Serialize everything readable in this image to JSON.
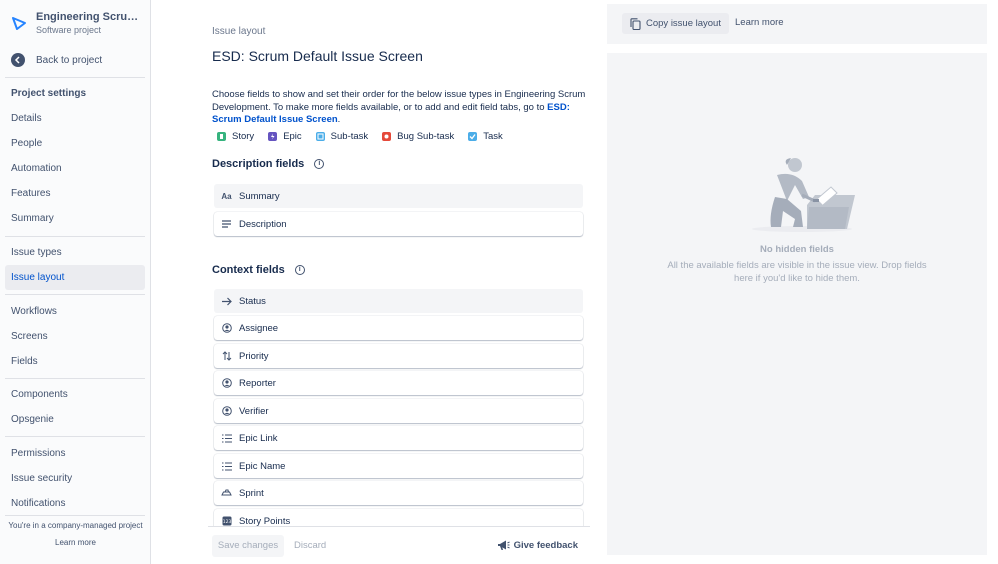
{
  "sidebar": {
    "project_name": "Engineering Scrum Development",
    "project_type": "Software project",
    "back_label": "Back to project",
    "section_title": "Project settings",
    "items": [
      {
        "label": "Details"
      },
      {
        "label": "People"
      },
      {
        "label": "Automation"
      },
      {
        "label": "Features"
      },
      {
        "label": "Summary"
      },
      {
        "label": "Issue types"
      },
      {
        "label": "Issue layout"
      },
      {
        "label": "Workflows"
      },
      {
        "label": "Screens"
      },
      {
        "label": "Fields"
      },
      {
        "label": "Components"
      },
      {
        "label": "Opsgenie"
      },
      {
        "label": "Permissions"
      },
      {
        "label": "Issue security"
      },
      {
        "label": "Notifications"
      }
    ],
    "active_item": "Issue layout",
    "footer_note": "You're in a company-managed project",
    "footer_link": "Learn more"
  },
  "main": {
    "breadcrumb": "Issue layout",
    "title": "ESD: Scrum Default Issue Screen",
    "description_part1": "Choose fields to show and set their order for the below issue types in Engineering Scrum Development. To make more fields available, or to add and edit field tabs, go to",
    "description_link": "ESD: Scrum Default Issue Screen",
    "description_end": ".",
    "issue_types": [
      {
        "label": "Story",
        "color": "#36b37e"
      },
      {
        "label": "Epic",
        "color": "#6554c0"
      },
      {
        "label": "Sub-task",
        "color": "#4bade8"
      },
      {
        "label": "Bug Sub-task",
        "color": "#e5493a"
      },
      {
        "label": "Task",
        "color": "#4bade8"
      }
    ],
    "description_fields_heading": "Description fields",
    "description_fields": [
      {
        "label": "Summary",
        "icon": "text-format-icon"
      },
      {
        "label": "Description",
        "icon": "paragraph-icon"
      }
    ],
    "context_fields_heading": "Context fields",
    "context_fields": [
      {
        "label": "Status",
        "icon": "arrow-right-icon"
      },
      {
        "label": "Assignee",
        "icon": "person-icon"
      },
      {
        "label": "Priority",
        "icon": "priority-arrows-icon"
      },
      {
        "label": "Reporter",
        "icon": "person-icon"
      },
      {
        "label": "Verifier",
        "icon": "person-icon"
      },
      {
        "label": "Epic Link",
        "icon": "list-icon"
      },
      {
        "label": "Epic Name",
        "icon": "list-icon"
      },
      {
        "label": "Sprint",
        "icon": "sprint-icon"
      },
      {
        "label": "Story Points",
        "icon": "number-icon"
      }
    ],
    "save_label": "Save changes",
    "discard_label": "Discard",
    "feedback_label": "Give feedback"
  },
  "right_panel": {
    "copy_label": "Copy issue layout",
    "learn_more": "Learn more",
    "empty_title": "No hidden fields",
    "empty_desc": "All the available fields are visible in the issue view. Drop fields here if you'd like to hide them."
  },
  "colors": {
    "link": "#0052cc",
    "active_nav_bg": "#ebecf0",
    "panel_bg": "#f4f5f7"
  }
}
